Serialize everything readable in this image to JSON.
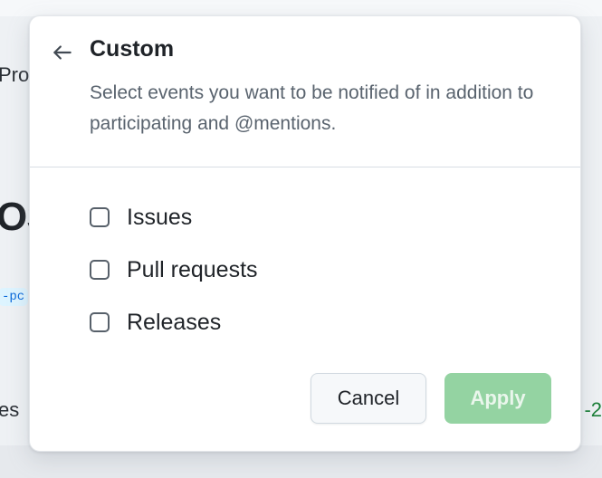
{
  "background": {
    "fragment_pro": "Pro",
    "fragment_os": "OS",
    "fragment_branch": "-pc",
    "fragment_es": "es",
    "fragment_right": "-2"
  },
  "popover": {
    "back_icon": "arrow-left-icon",
    "title": "Custom",
    "description": "Select events you want to be notified of in addition to participating and @mentions.",
    "options": [
      {
        "label": "Issues",
        "checked": false
      },
      {
        "label": "Pull requests",
        "checked": false
      },
      {
        "label": "Releases",
        "checked": false
      }
    ],
    "cancel_label": "Cancel",
    "apply_label": "Apply",
    "apply_disabled": true
  },
  "colors": {
    "apply_disabled_bg": "#94d3a2",
    "text_primary": "#1f2328",
    "text_muted": "#59636e"
  }
}
